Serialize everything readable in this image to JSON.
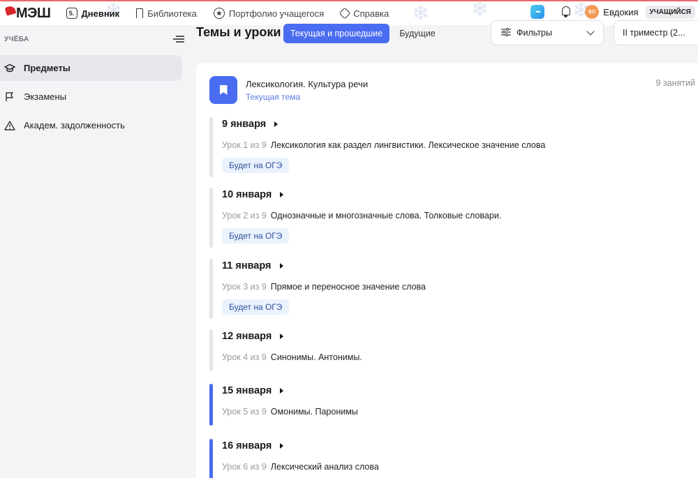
{
  "topbar": {
    "logo": "МЭШ",
    "nav": [
      {
        "label": "Дневник",
        "icon": "diary-icon",
        "badge": "5."
      },
      {
        "label": "Библиотека",
        "icon": "bookmark-outline-icon"
      },
      {
        "label": "Портфолио учащегося",
        "icon": "star-icon"
      },
      {
        "label": "Справка",
        "icon": "help-icon"
      }
    ],
    "chat_icon": "chat-icon",
    "notifications_icon": "bell-icon",
    "avatar_initials": "ЕС",
    "user_name": "Евдокия",
    "role": "УЧАЩИЙСЯ"
  },
  "sidebar": {
    "section": "УЧЁБА",
    "items": [
      {
        "label": "Предметы",
        "icon": "graduation-cap-icon",
        "active": true
      },
      {
        "label": "Экзамены",
        "icon": "flag-icon",
        "active": false
      },
      {
        "label": "Академ. задолженность",
        "icon": "warning-icon",
        "active": false
      }
    ]
  },
  "header": {
    "title": "Темы и уроки",
    "tabs": [
      {
        "label": "Текущая и прошедшие",
        "active": true
      },
      {
        "label": "Будущие",
        "active": false
      }
    ],
    "filters_label": "Фильтры",
    "period_label": "II триместр (2..."
  },
  "topic": {
    "name": "Лексикология. Культура речи",
    "status": "Текущая тема",
    "lessons_count": "9 занятий"
  },
  "lessons": [
    {
      "date": "9 января",
      "number": "Урок 1 из 9",
      "title": "Лексикология как раздел лингвистики. Лексическое значение слова",
      "badge": "Будет на ОГЭ",
      "current": false
    },
    {
      "date": "10 января",
      "number": "Урок 2 из 9",
      "title": "Однозначные и многозначные слова. Толковые словари.",
      "badge": "Будет на ОГЭ",
      "current": false
    },
    {
      "date": "11 января",
      "number": "Урок 3 из 9",
      "title": "Прямое и переносное значение слова",
      "badge": "Будет на ОГЭ",
      "current": false
    },
    {
      "date": "12 января",
      "number": "Урок 4 из 9",
      "title": "Синонимы. Антонимы.",
      "badge": null,
      "current": false
    },
    {
      "date": "15 января",
      "number": "Урок 5 из 9",
      "title": "Омонимы. Паронимы",
      "badge": null,
      "current": true
    },
    {
      "date": "16 января",
      "number": "Урок 6 из 9",
      "title": "Лексический анализ слова",
      "badge": null,
      "current": true
    }
  ],
  "colors": {
    "accent": "#4a6cf0",
    "badge_bg": "#eaf2fd",
    "avatar": "#f39a56"
  }
}
